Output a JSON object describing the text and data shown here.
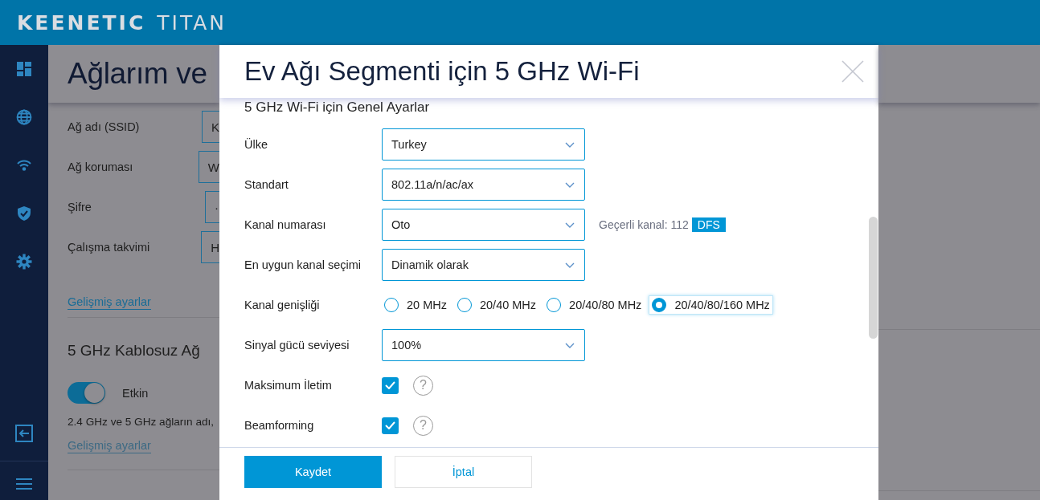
{
  "header": {
    "brand": "KEENETIC",
    "model": "TITAN"
  },
  "background": {
    "title": "Ağlarım ve",
    "fields": [
      {
        "label": "Ağ adı (SSID)",
        "value": "K"
      },
      {
        "label": "Ağ koruması",
        "value": "W"
      },
      {
        "label": "Şifre",
        "value": "·"
      },
      {
        "label": "Çalışma takvimi",
        "value": "H"
      }
    ],
    "links": [
      {
        "label": "Gelişmiş ayarlar",
        "disabled": false
      }
    ],
    "section": "5 GHz Kablosuz Ağ",
    "toggle": {
      "label": "Etkin",
      "on": true
    },
    "note": "2.4 GHz ve 5 GHz ağların adı,",
    "links2": [
      {
        "label": "Gelişmiş ayarlar",
        "disabled": true
      }
    ]
  },
  "modal": {
    "title": "Ev Ağı Segmenti için 5 GHz Wi-Fi",
    "section_title": "5 GHz Wi-Fi için Genel Ayarlar",
    "rows": [
      {
        "kind": "select",
        "label": "Ülke",
        "value": "Turkey"
      },
      {
        "kind": "select",
        "label": "Standart",
        "value": "802.11a/n/ac/ax"
      },
      {
        "kind": "select",
        "label": "Kanal numarası",
        "value": "Oto",
        "info": "Geçerli kanal: 112",
        "badge": "DFS"
      },
      {
        "kind": "select",
        "label": "En uygun kanal seçimi",
        "value": "Dinamik olarak"
      },
      {
        "kind": "radio",
        "label": "Kanal genişliği",
        "options": [
          {
            "label": "20 MHz",
            "selected": false
          },
          {
            "label": "20/40 MHz",
            "selected": false
          },
          {
            "label": "20/40/80 MHz",
            "selected": false
          },
          {
            "label": "20/40/80/160 MHz",
            "selected": true
          }
        ]
      },
      {
        "kind": "select",
        "label": "Sinyal gücü seviyesi",
        "value": "100%"
      },
      {
        "kind": "checkbox",
        "label": "Maksimum İletim",
        "checked": true,
        "help": "?"
      },
      {
        "kind": "checkbox",
        "label": "Beamforming",
        "checked": true,
        "help": "?"
      }
    ],
    "buttons": [
      {
        "label": "Kaydet",
        "primary": true
      },
      {
        "label": "İptal",
        "primary": false
      }
    ]
  }
}
